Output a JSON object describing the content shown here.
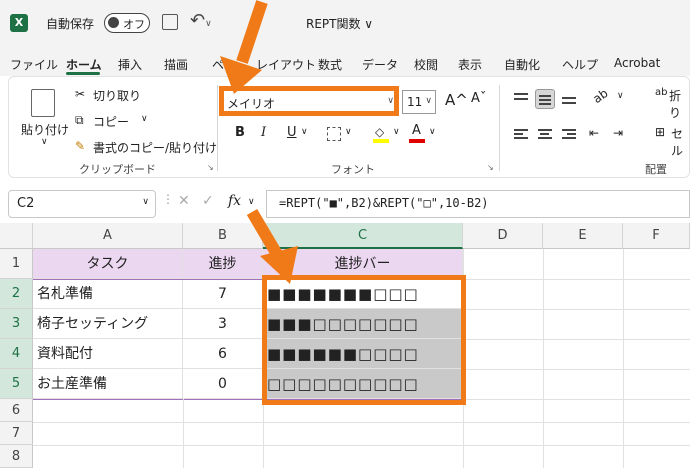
{
  "titlebar": {
    "logo": "X",
    "autosave_label": "自動保存",
    "autosave_state": "オフ",
    "doc_name": "REPT関数 ∨"
  },
  "tabs": [
    "ファイル",
    "ホーム",
    "挿入",
    "描画",
    "ペ",
    "レイアウト",
    "数式",
    "データ",
    "校閲",
    "表示",
    "自動化",
    "ヘルプ",
    "Acrobat"
  ],
  "active_tab": "ホーム",
  "ribbon": {
    "clipboard": {
      "paste_label": "貼り付け",
      "cut": "切り取り",
      "copy": "コピー",
      "format_painter": "書式のコピー/貼り付け",
      "group_label": "クリップボード"
    },
    "font": {
      "font_name": "メイリオ",
      "font_size": "11",
      "grow_icon": "A^",
      "shrink_icon": "Aˇ",
      "bold": "B",
      "italic": "I",
      "underline": "U",
      "font_color_icon": "A",
      "group_label": "フォント"
    },
    "alignment": {
      "wrap": "折り",
      "merge": "セル",
      "group_label": "配置"
    }
  },
  "formula_bar": {
    "name_box": "C2",
    "fx": "fx",
    "formula": "=REPT(\"■\",B2)&REPT(\"□\",10-B2)"
  },
  "grid": {
    "columns": [
      "A",
      "B",
      "C",
      "D",
      "E",
      "F"
    ],
    "rows": [
      "1",
      "2",
      "3",
      "4",
      "5",
      "6",
      "7",
      "8"
    ],
    "header": [
      "タスク",
      "進捗",
      "進捗バー"
    ],
    "data": [
      {
        "task": "名札準備",
        "progress": "7",
        "bar": "■■■■■■■□□□"
      },
      {
        "task": "椅子セッティング",
        "progress": "3",
        "bar": "■■■□□□□□□□"
      },
      {
        "task": "資料配付",
        "progress": "6",
        "bar": "■■■■■■□□□□"
      },
      {
        "task": "お土産準備",
        "progress": "0",
        "bar": "□□□□□□□□□□"
      }
    ]
  },
  "colors": {
    "excel_green": "#1e7145",
    "highlight_orange": "#f07a17",
    "header_fill": "#ecd7f0",
    "bar_fill": "#c9c9c9"
  }
}
